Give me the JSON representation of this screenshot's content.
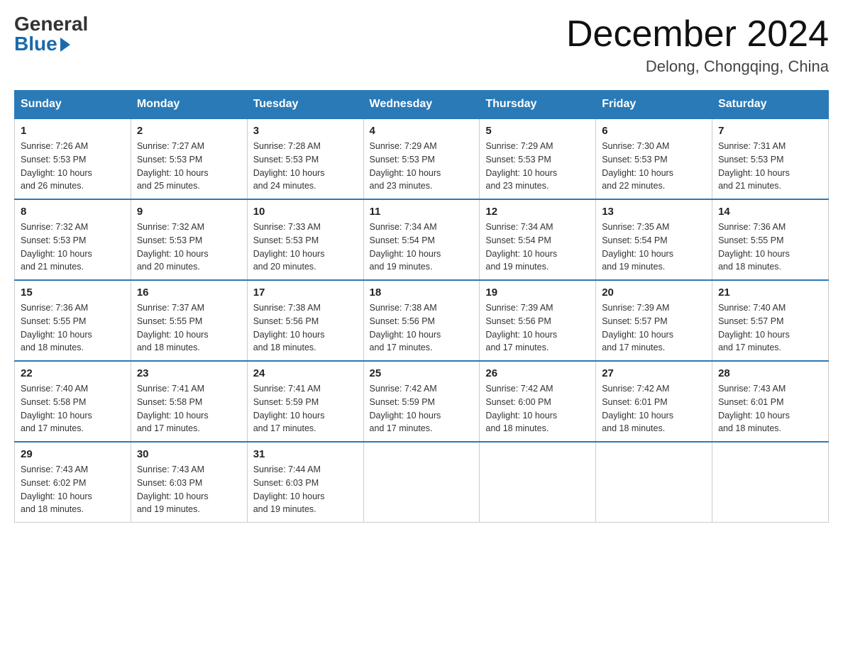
{
  "header": {
    "logo_general": "General",
    "logo_blue": "Blue",
    "month_title": "December 2024",
    "location": "Delong, Chongqing, China"
  },
  "weekdays": [
    "Sunday",
    "Monday",
    "Tuesday",
    "Wednesday",
    "Thursday",
    "Friday",
    "Saturday"
  ],
  "weeks": [
    [
      {
        "day": "1",
        "info": "Sunrise: 7:26 AM\nSunset: 5:53 PM\nDaylight: 10 hours\nand 26 minutes."
      },
      {
        "day": "2",
        "info": "Sunrise: 7:27 AM\nSunset: 5:53 PM\nDaylight: 10 hours\nand 25 minutes."
      },
      {
        "day": "3",
        "info": "Sunrise: 7:28 AM\nSunset: 5:53 PM\nDaylight: 10 hours\nand 24 minutes."
      },
      {
        "day": "4",
        "info": "Sunrise: 7:29 AM\nSunset: 5:53 PM\nDaylight: 10 hours\nand 23 minutes."
      },
      {
        "day": "5",
        "info": "Sunrise: 7:29 AM\nSunset: 5:53 PM\nDaylight: 10 hours\nand 23 minutes."
      },
      {
        "day": "6",
        "info": "Sunrise: 7:30 AM\nSunset: 5:53 PM\nDaylight: 10 hours\nand 22 minutes."
      },
      {
        "day": "7",
        "info": "Sunrise: 7:31 AM\nSunset: 5:53 PM\nDaylight: 10 hours\nand 21 minutes."
      }
    ],
    [
      {
        "day": "8",
        "info": "Sunrise: 7:32 AM\nSunset: 5:53 PM\nDaylight: 10 hours\nand 21 minutes."
      },
      {
        "day": "9",
        "info": "Sunrise: 7:32 AM\nSunset: 5:53 PM\nDaylight: 10 hours\nand 20 minutes."
      },
      {
        "day": "10",
        "info": "Sunrise: 7:33 AM\nSunset: 5:53 PM\nDaylight: 10 hours\nand 20 minutes."
      },
      {
        "day": "11",
        "info": "Sunrise: 7:34 AM\nSunset: 5:54 PM\nDaylight: 10 hours\nand 19 minutes."
      },
      {
        "day": "12",
        "info": "Sunrise: 7:34 AM\nSunset: 5:54 PM\nDaylight: 10 hours\nand 19 minutes."
      },
      {
        "day": "13",
        "info": "Sunrise: 7:35 AM\nSunset: 5:54 PM\nDaylight: 10 hours\nand 19 minutes."
      },
      {
        "day": "14",
        "info": "Sunrise: 7:36 AM\nSunset: 5:55 PM\nDaylight: 10 hours\nand 18 minutes."
      }
    ],
    [
      {
        "day": "15",
        "info": "Sunrise: 7:36 AM\nSunset: 5:55 PM\nDaylight: 10 hours\nand 18 minutes."
      },
      {
        "day": "16",
        "info": "Sunrise: 7:37 AM\nSunset: 5:55 PM\nDaylight: 10 hours\nand 18 minutes."
      },
      {
        "day": "17",
        "info": "Sunrise: 7:38 AM\nSunset: 5:56 PM\nDaylight: 10 hours\nand 18 minutes."
      },
      {
        "day": "18",
        "info": "Sunrise: 7:38 AM\nSunset: 5:56 PM\nDaylight: 10 hours\nand 17 minutes."
      },
      {
        "day": "19",
        "info": "Sunrise: 7:39 AM\nSunset: 5:56 PM\nDaylight: 10 hours\nand 17 minutes."
      },
      {
        "day": "20",
        "info": "Sunrise: 7:39 AM\nSunset: 5:57 PM\nDaylight: 10 hours\nand 17 minutes."
      },
      {
        "day": "21",
        "info": "Sunrise: 7:40 AM\nSunset: 5:57 PM\nDaylight: 10 hours\nand 17 minutes."
      }
    ],
    [
      {
        "day": "22",
        "info": "Sunrise: 7:40 AM\nSunset: 5:58 PM\nDaylight: 10 hours\nand 17 minutes."
      },
      {
        "day": "23",
        "info": "Sunrise: 7:41 AM\nSunset: 5:58 PM\nDaylight: 10 hours\nand 17 minutes."
      },
      {
        "day": "24",
        "info": "Sunrise: 7:41 AM\nSunset: 5:59 PM\nDaylight: 10 hours\nand 17 minutes."
      },
      {
        "day": "25",
        "info": "Sunrise: 7:42 AM\nSunset: 5:59 PM\nDaylight: 10 hours\nand 17 minutes."
      },
      {
        "day": "26",
        "info": "Sunrise: 7:42 AM\nSunset: 6:00 PM\nDaylight: 10 hours\nand 18 minutes."
      },
      {
        "day": "27",
        "info": "Sunrise: 7:42 AM\nSunset: 6:01 PM\nDaylight: 10 hours\nand 18 minutes."
      },
      {
        "day": "28",
        "info": "Sunrise: 7:43 AM\nSunset: 6:01 PM\nDaylight: 10 hours\nand 18 minutes."
      }
    ],
    [
      {
        "day": "29",
        "info": "Sunrise: 7:43 AM\nSunset: 6:02 PM\nDaylight: 10 hours\nand 18 minutes."
      },
      {
        "day": "30",
        "info": "Sunrise: 7:43 AM\nSunset: 6:03 PM\nDaylight: 10 hours\nand 19 minutes."
      },
      {
        "day": "31",
        "info": "Sunrise: 7:44 AM\nSunset: 6:03 PM\nDaylight: 10 hours\nand 19 minutes."
      },
      {
        "day": "",
        "info": ""
      },
      {
        "day": "",
        "info": ""
      },
      {
        "day": "",
        "info": ""
      },
      {
        "day": "",
        "info": ""
      }
    ]
  ]
}
